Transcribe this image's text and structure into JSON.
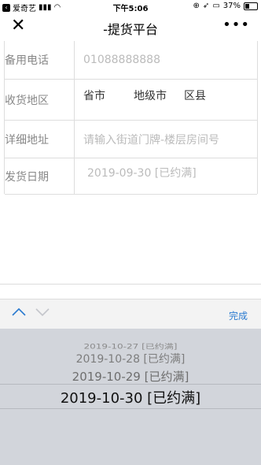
{
  "status_bar": {
    "carrier": "爱奇艺",
    "time": "下午5:06",
    "battery": "37%"
  },
  "navbar": {
    "close_icon": "close-icon",
    "title": "-提货平台",
    "more_icon": "more-icon"
  },
  "form": {
    "rows": [
      {
        "label": "备用电话",
        "value": "01088888888"
      },
      {
        "label": "收货地区",
        "province": "省市",
        "city": "地级市",
        "county": "区县"
      },
      {
        "label": "详细地址",
        "placeholder": "请输入街道门牌-楼层房间号"
      },
      {
        "label": "发货日期",
        "value": "2019-09-30 [已约满]"
      }
    ]
  },
  "toolbar": {
    "done_label": "完成"
  },
  "picker": {
    "options": [
      "2019-10-27 [已约满]",
      "2019-10-28 [已约满]",
      "2019-10-29 [已约满]",
      "2019-10-30 [已约满]"
    ],
    "selected": "2019-10-30 [已约满]"
  },
  "colors": {
    "accent": "#2b7bd0",
    "picker_bg": "#d2d5db",
    "border": "#dddddd"
  }
}
